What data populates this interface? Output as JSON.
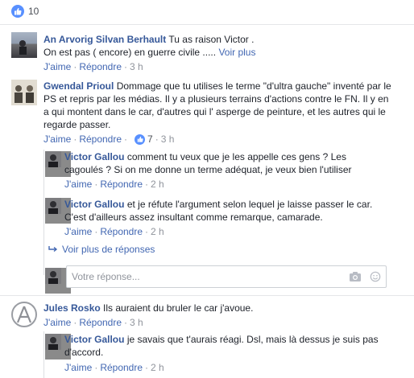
{
  "reactions": {
    "count": "10"
  },
  "comments": [
    {
      "author": "An Arvorig Silvan Berhault",
      "text_line1": "Tu as raison Victor .",
      "text_line2": "On est pas ( encore) en guerre civile .....",
      "see_more": "Voir plus",
      "like": "J'aime",
      "reply": "Répondre",
      "time": "3 h"
    },
    {
      "author": "Gwendal Prioul",
      "text_line1": "Dommage que tu utilises le terme \"d'ultra gauche\" inventé par le",
      "text_line2": "PS et repris par les médias. Il y a plusieurs terrains d'actions contre le FN. Il y en",
      "text_line3": "a qui montent dans le car, d'autres qui l' asperge de peinture, et les autres qui le",
      "text_line4": "regarde passer.",
      "like": "J'aime",
      "reply": "Répondre",
      "reaction_count": "7",
      "time": "3 h",
      "replies": [
        {
          "author": "Victor Gallou",
          "text_line1": "comment tu veux que je les appelle ces gens ? Les",
          "text_line2": "cagoulés ? Si on me donne un terme adéquat, je veux bien l'utiliser",
          "like": "J'aime",
          "reply": "Répondre",
          "time": "2 h"
        },
        {
          "author": "Victor Gallou",
          "text_line1": "et je réfute l'argument selon lequel je laisse passer le car.",
          "text_line2": "C'est d'ailleurs assez insultant comme remarque, camarade.",
          "like": "J'aime",
          "reply": "Répondre",
          "time": "2 h"
        }
      ],
      "more_replies": "Voir plus de réponses",
      "reply_placeholder": "Votre réponse..."
    },
    {
      "author": "Jules Rosko",
      "text_line1": "Ils auraient du bruler le car j'avoue.",
      "like": "J'aime",
      "reply": "Répondre",
      "time": "3 h",
      "replies": [
        {
          "author": "Victor Gallou",
          "text_line1": "je savais que t'aurais réagi. Dsl, mais là dessus je suis pas",
          "text_line2": "d'accord.",
          "like": "J'aime",
          "reply": "Répondre",
          "time": "2 h"
        }
      ]
    }
  ]
}
